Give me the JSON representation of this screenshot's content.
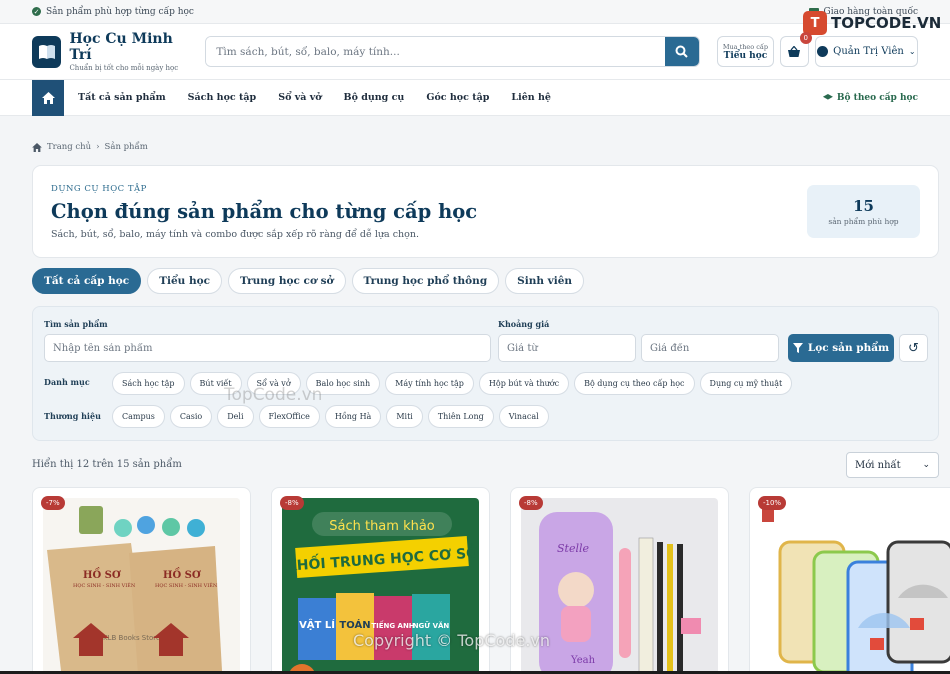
{
  "topbar": {
    "left_text": "Sản phẩm phù hợp từng cấp học",
    "right_text": "Giao hàng toàn quốc"
  },
  "watermark": {
    "badge": "T",
    "text": "TOPCODE.VN",
    "mid": "TopCode.vn",
    "copyright": "Copyright © TopCode.vn"
  },
  "header": {
    "brand_name": "Học Cụ Minh Trí",
    "brand_tagline": "Chuẩn bị tốt cho mỗi ngày học",
    "search_placeholder": "Tìm sách, bút, sổ, balo, máy tính...",
    "level_small": "Mua theo cấp",
    "level_big": "Tiểu học",
    "cart_count": "0",
    "user_name": "Quản Trị Viên"
  },
  "nav": {
    "links": [
      "Tất cả sản phẩm",
      "Sách học tập",
      "Sổ và vở",
      "Bộ dụng cụ",
      "Góc học tập",
      "Liên hệ"
    ],
    "right_link": "Bộ theo cấp học"
  },
  "breadcrumb": {
    "home": "Trang chủ",
    "current": "Sản phẩm"
  },
  "hero": {
    "eyebrow": "DỤNG CỤ HỌC TẬP",
    "title": "Chọn đúng sản phẩm cho từng cấp học",
    "subtitle": "Sách, bút, sổ, balo, máy tính và combo được sắp xếp rõ ràng để dễ lựa chọn.",
    "count": "15",
    "count_label": "sản phẩm phù hợp"
  },
  "level_tabs": [
    "Tất cả cấp học",
    "Tiểu học",
    "Trung học cơ sở",
    "Trung học phổ thông",
    "Sinh viên"
  ],
  "filter": {
    "search_label": "Tìm sản phẩm",
    "search_placeholder": "Nhập tên sản phẩm",
    "price_label": "Khoảng giá",
    "price_from_placeholder": "Giá từ",
    "price_to_placeholder": "Giá đến",
    "filter_button": "Lọc sản phẩm",
    "category_label": "Danh mục",
    "categories": [
      "Sách học tập",
      "Bút viết",
      "Sổ và vở",
      "Balo học sinh",
      "Máy tính học tập",
      "Hộp bút và thước",
      "Bộ dụng cụ theo cấp học",
      "Dụng cụ mỹ thuật"
    ],
    "brand_label": "Thương hiệu",
    "brands": [
      "Campus",
      "Casio",
      "Deli",
      "FlexOffice",
      "Hồng Hà",
      "Miti",
      "Thiên Long",
      "Vinacal"
    ]
  },
  "results": {
    "text": "Hiển thị 12 trên 15 sản phẩm",
    "sort_value": "Mới nhất"
  },
  "products": [
    {
      "discount": "-7%",
      "img_text_1": "HỒ SƠ",
      "img_text_2": "HỌC SINH - SINH VIÊN",
      "img_text_3": "KLB Books Store"
    },
    {
      "discount": "-8%",
      "img_text_1": "Sách tham khảo",
      "img_text_2": "KHỐI TRUNG HỌC CƠ SỞ",
      "img_text_3": "VẬT LÍ",
      "img_text_4": "TOÁN",
      "img_text_5": "TIẾNG ANH",
      "img_text_6": "NGỮ VĂN"
    },
    {
      "discount": "-8%",
      "img_text_1": "Stelle",
      "img_text_2": "Yeah"
    },
    {
      "discount": "-10%"
    }
  ],
  "colors": {
    "primary": "#2a6a93",
    "navy": "#0e3a5a",
    "discount": "#b83a36",
    "green": "#2a6a4f"
  }
}
